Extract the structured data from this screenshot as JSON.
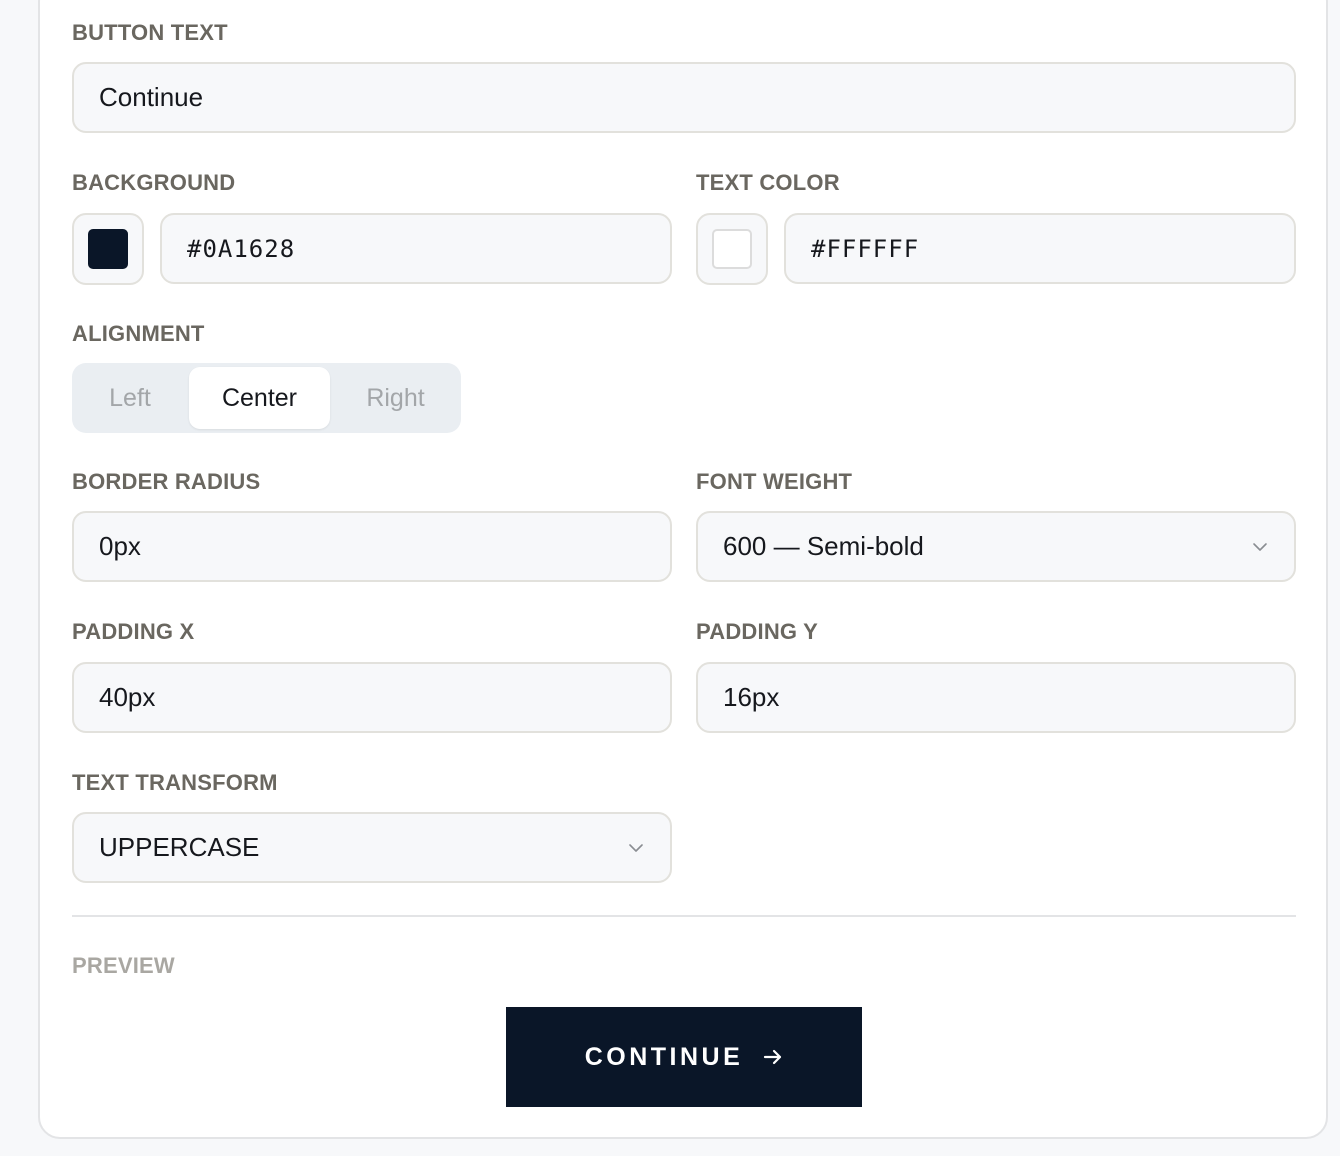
{
  "colors": {
    "page_bg": "#f7f8fa",
    "card_bg": "#ffffff",
    "label": "#6a6760",
    "field_bg": "#f7f8fa",
    "field_border": "#e2e1dc",
    "preview_bg": "#0A1628",
    "preview_text": "#FFFFFF"
  },
  "button_text": {
    "label": "BUTTON TEXT",
    "value": "Continue"
  },
  "background": {
    "label": "BACKGROUND",
    "value": "#0A1628",
    "swatch_color": "#0A1628"
  },
  "text_color": {
    "label": "TEXT COLOR",
    "value": "#FFFFFF",
    "swatch_color": "#FFFFFF"
  },
  "alignment": {
    "label": "ALIGNMENT",
    "options": [
      "Left",
      "Center",
      "Right"
    ],
    "selected": "Center"
  },
  "border_radius": {
    "label": "BORDER RADIUS",
    "value": "0px"
  },
  "font_weight": {
    "label": "FONT WEIGHT",
    "value": "600 — Semi-bold",
    "icon": "chevron-down-icon"
  },
  "padding_x": {
    "label": "PADDING X",
    "value": "40px"
  },
  "padding_y": {
    "label": "PADDING Y",
    "value": "16px"
  },
  "text_transform": {
    "label": "TEXT TRANSFORM",
    "value": "UPPERCASE",
    "icon": "chevron-down-icon"
  },
  "preview": {
    "label": "PREVIEW",
    "button_label": "CONTINUE",
    "icon": "arrow-right-icon"
  }
}
